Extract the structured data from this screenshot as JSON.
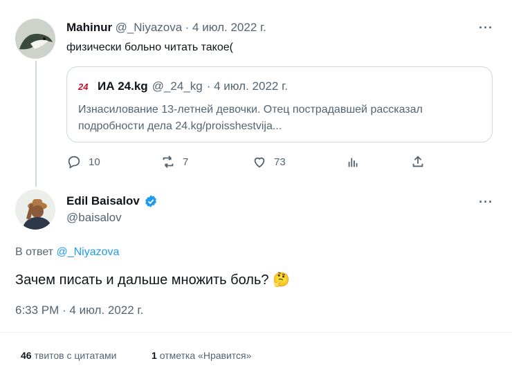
{
  "parent_tweet": {
    "author_name": "Mahinur",
    "author_handle": "@_Niyazova",
    "date": "· 4 июл. 2022 г.",
    "text": "физически больно читать такое(",
    "quoted": {
      "author_name": "ИА 24.kg",
      "author_handle": "@_24_kg",
      "date": "· 4 июл. 2022 г.",
      "text_line1": "Изнасилование 13-летней девочки. Отец пострадавшей рассказал",
      "text_line2": "подробности дела 24.kg/proisshestvija..."
    },
    "actions": {
      "replies": "10",
      "retweets": "7",
      "likes": "73"
    }
  },
  "main_tweet": {
    "author_name": "Edil Baisalov",
    "author_handle": "@baisalov",
    "reply_prefix": "В ответ",
    "reply_to": "@_Niyazova",
    "text": "Зачем писать и дальше множить боль?",
    "emoji": "🤔",
    "timestamp": "6:33 PM · 4 июл. 2022 г."
  },
  "stats": {
    "quote_count": "46",
    "quote_label": "твитов с цитатами",
    "like_count": "1",
    "like_label": "отметка «Нравится»"
  },
  "more_label": "···",
  "colors": {
    "accent": "#1d9bf0",
    "secondary": "#536471",
    "border": "#cfd9de",
    "verified": "#1d9bf0"
  }
}
